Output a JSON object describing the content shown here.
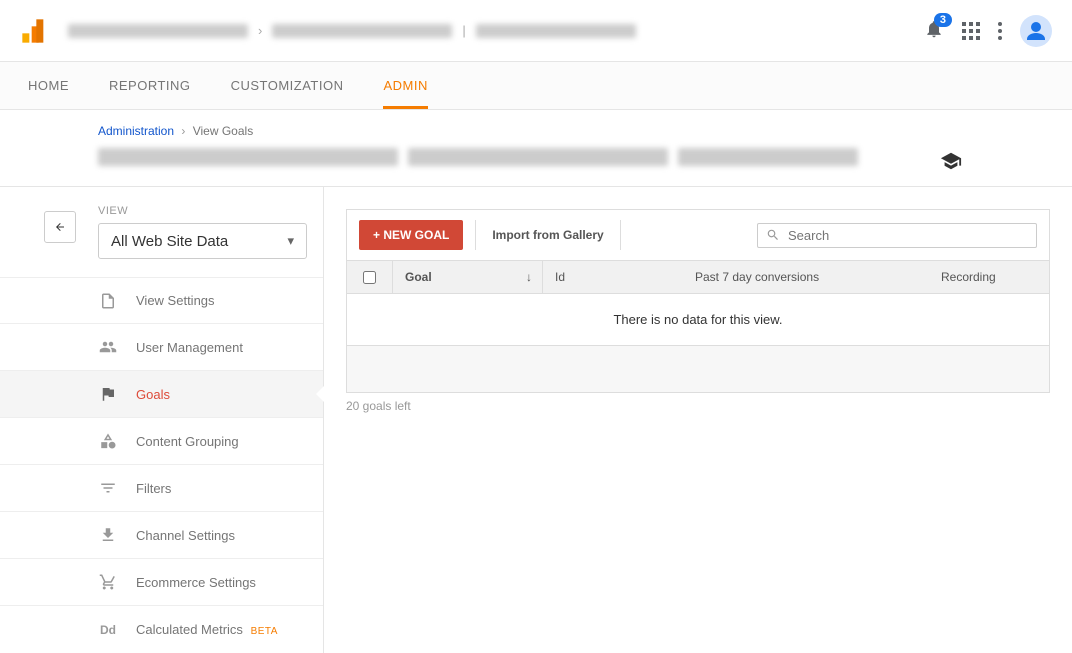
{
  "header": {
    "notification_count": "3"
  },
  "tabs": {
    "home": "HOME",
    "reporting": "REPORTING",
    "customization": "CUSTOMIZATION",
    "admin": "ADMIN"
  },
  "breadcrumb": {
    "administration": "Administration",
    "view_goals": "View Goals"
  },
  "sidebar": {
    "view_label": "VIEW",
    "view_value": "All Web Site Data",
    "items": {
      "view_settings": "View Settings",
      "user_management": "User Management",
      "goals": "Goals",
      "content_grouping": "Content Grouping",
      "filters": "Filters",
      "channel_settings": "Channel Settings",
      "ecommerce_settings": "Ecommerce Settings",
      "calculated_metrics": "Calculated Metrics",
      "beta": "BETA"
    }
  },
  "panel": {
    "new_goal": "+ NEW GOAL",
    "import_gallery": "Import from Gallery",
    "search_placeholder": "Search",
    "columns": {
      "goal": "Goal",
      "id": "Id",
      "conversions": "Past 7 day conversions",
      "recording": "Recording"
    },
    "empty_message": "There is no data for this view.",
    "goals_left": "20 goals left"
  }
}
